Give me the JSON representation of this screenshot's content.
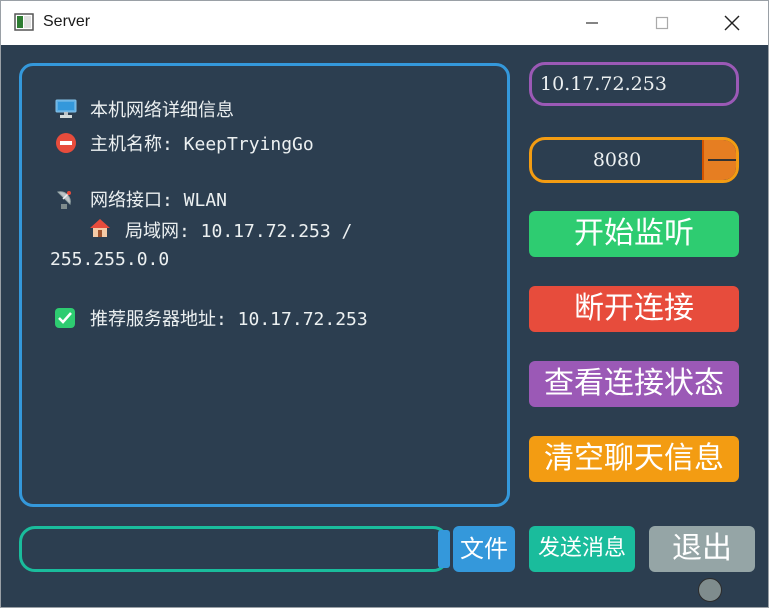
{
  "window": {
    "title": "Server"
  },
  "info": {
    "heading": "本机网络详细信息",
    "hostname": "主机名称: KeepTryingGo",
    "interface": "网络接口: WLAN",
    "lan_line1": "局域网: 10.17.72.253 /",
    "lan_line2": "255.255.0.0",
    "recommended": "推荐服务器地址: 10.17.72.253"
  },
  "connection": {
    "ip": "10.17.72.253",
    "port": "8080"
  },
  "buttons": {
    "listen": "开始监听",
    "disconnect": "断开连接",
    "status": "查看连接状态",
    "clear": "清空聊天信息",
    "file": "文件",
    "send": "发送消息",
    "exit": "退出"
  },
  "message": {
    "value": ""
  },
  "icons": [
    "computer-icon",
    "no-entry-icon",
    "satellite-antenna-icon",
    "house-icon",
    "check-mark-icon"
  ],
  "colors": {
    "background": "#2c3e50",
    "info_border": "#3498db",
    "ip_border": "#9b59b6",
    "port_border": "#f39c12",
    "listen": "#2ecc71",
    "disconnect": "#e74c3c",
    "status": "#9b59b6",
    "clear": "#f39c12",
    "input_border": "#1abc9c",
    "file": "#3498db",
    "send": "#1abc9c",
    "exit": "#95a5a6"
  }
}
